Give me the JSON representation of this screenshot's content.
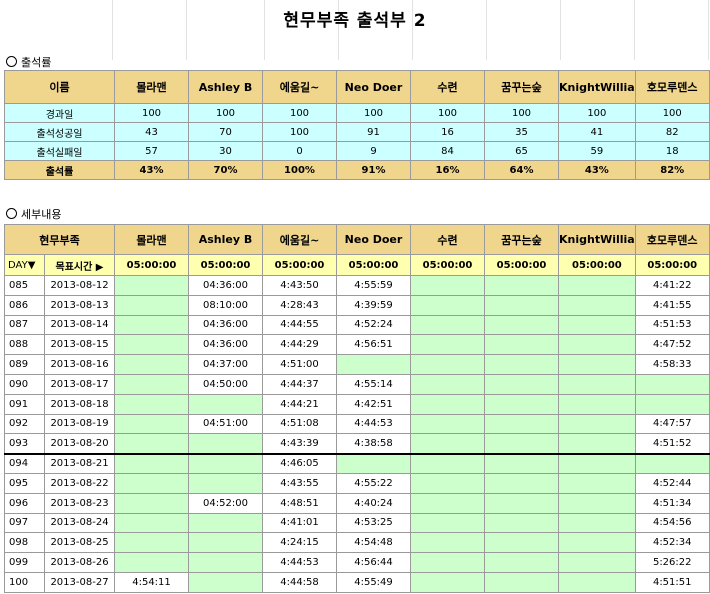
{
  "title": "현무부족 출석부 2",
  "section1_label": "출석률",
  "section2_label": "세부내용",
  "members": [
    "몰라맨",
    "Ashley B",
    "에움길~",
    "Neo Doer",
    "수련",
    "꿈꾸는숲",
    "KnightWillia",
    "호모루덴스"
  ],
  "summary": {
    "header_label": "이름",
    "rows": [
      {
        "label": "경과일",
        "values": [
          "100",
          "100",
          "100",
          "100",
          "100",
          "100",
          "100",
          "100"
        ]
      },
      {
        "label": "출석성공일",
        "values": [
          "43",
          "70",
          "100",
          "91",
          "16",
          "35",
          "41",
          "82"
        ]
      },
      {
        "label": "출석실패일",
        "values": [
          "57",
          "30",
          "0",
          "9",
          "84",
          "65",
          "59",
          "18"
        ]
      }
    ],
    "rate_label": "출석률",
    "rates": [
      "43%",
      "70%",
      "100%",
      "91%",
      "16%",
      "64%",
      "43%",
      "82%"
    ]
  },
  "detail": {
    "header_label": "현무부족",
    "day_label": "DAY▼",
    "target_label": "목표시간 ▶",
    "target_times": [
      "05:00:00",
      "05:00:00",
      "05:00:00",
      "05:00:00",
      "05:00:00",
      "05:00:00",
      "05:00:00",
      "05:00:00"
    ],
    "rows": [
      {
        "day": "085",
        "date": "2013-08-12",
        "times": [
          "",
          "04:36:00",
          "4:43:50",
          "4:55:59",
          "",
          "",
          "",
          "4:41:22"
        ]
      },
      {
        "day": "086",
        "date": "2013-08-13",
        "times": [
          "",
          "08:10:00",
          "4:28:43",
          "4:39:59",
          "",
          "",
          "",
          "4:41:55"
        ]
      },
      {
        "day": "087",
        "date": "2013-08-14",
        "times": [
          "",
          "04:36:00",
          "4:44:55",
          "4:52:24",
          "",
          "",
          "",
          "4:51:53"
        ]
      },
      {
        "day": "088",
        "date": "2013-08-15",
        "times": [
          "",
          "04:36:00",
          "4:44:29",
          "4:56:51",
          "",
          "",
          "",
          "4:47:52"
        ]
      },
      {
        "day": "089",
        "date": "2013-08-16",
        "times": [
          "",
          "04:37:00",
          "4:51:00",
          "",
          "",
          "",
          "",
          "4:58:33"
        ]
      },
      {
        "day": "090",
        "date": "2013-08-17",
        "times": [
          "",
          "04:50:00",
          "4:44:37",
          "4:55:14",
          "",
          "",
          "",
          ""
        ]
      },
      {
        "day": "091",
        "date": "2013-08-18",
        "times": [
          "",
          "",
          "4:44:21",
          "4:42:51",
          "",
          "",
          "",
          ""
        ]
      },
      {
        "day": "092",
        "date": "2013-08-19",
        "times": [
          "",
          "04:51:00",
          "4:51:08",
          "4:44:53",
          "",
          "",
          "",
          "4:47:57"
        ]
      },
      {
        "day": "093",
        "date": "2013-08-20",
        "times": [
          "",
          "",
          "4:43:39",
          "4:38:58",
          "",
          "",
          "",
          "4:51:52"
        ]
      },
      {
        "day": "094",
        "date": "2013-08-21",
        "times": [
          "",
          "",
          "4:46:05",
          "",
          "",
          "",
          "",
          ""
        ]
      },
      {
        "day": "095",
        "date": "2013-08-22",
        "times": [
          "",
          "",
          "4:43:55",
          "4:55:22",
          "",
          "",
          "",
          "4:52:44"
        ]
      },
      {
        "day": "096",
        "date": "2013-08-23",
        "times": [
          "",
          "04:52:00",
          "4:48:51",
          "4:40:24",
          "",
          "",
          "",
          "4:51:34"
        ]
      },
      {
        "day": "097",
        "date": "2013-08-24",
        "times": [
          "",
          "",
          "4:41:01",
          "4:53:25",
          "",
          "",
          "",
          "4:54:56"
        ]
      },
      {
        "day": "098",
        "date": "2013-08-25",
        "times": [
          "",
          "",
          "4:24:15",
          "4:54:48",
          "",
          "",
          "",
          "4:52:34"
        ]
      },
      {
        "day": "099",
        "date": "2013-08-26",
        "times": [
          "",
          "",
          "4:44:53",
          "4:56:44",
          "",
          "",
          "",
          "5:26:22"
        ]
      },
      {
        "day": "100",
        "date": "2013-08-27",
        "times": [
          "4:54:11",
          "",
          "4:44:58",
          "4:55:49",
          "",
          "",
          "",
          "4:51:51"
        ]
      }
    ]
  }
}
